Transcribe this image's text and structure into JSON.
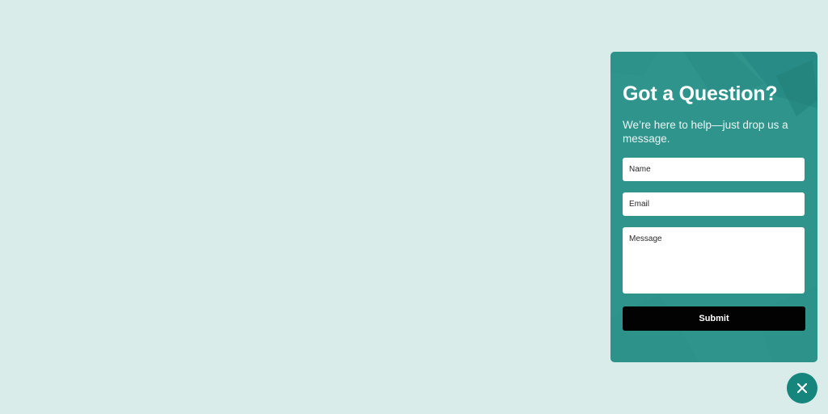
{
  "contact_widget": {
    "title": "Got a Question?",
    "subtitle": "We’re here to help—just drop us a message.",
    "fields": {
      "name_placeholder": "Name",
      "email_placeholder": "Email",
      "message_placeholder": "Message"
    },
    "submit_label": "Submit"
  },
  "close_button": {
    "icon": "close-icon"
  },
  "colors": {
    "page_background": "#daecea",
    "panel_background": "#2f948c",
    "submit_background": "#020202",
    "close_button_background": "#16857c"
  }
}
